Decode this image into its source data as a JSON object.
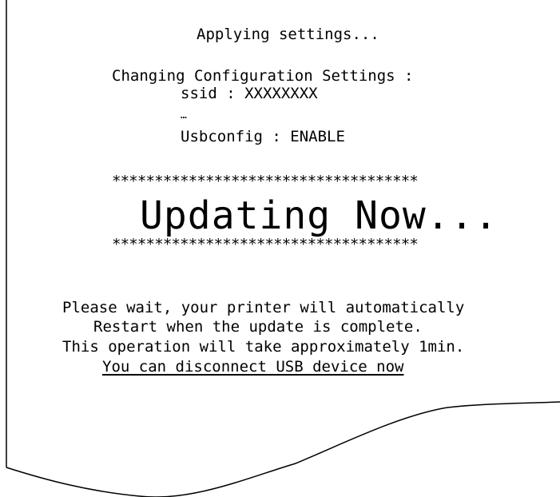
{
  "receipt": {
    "applying": "Applying settings...",
    "changing": "Changing Configuration Settings :",
    "ssid": "ssid : XXXXXXXX",
    "ellipsis": "…",
    "usbconfig": "Usbconfig : ENABLE",
    "stars_top": "************************************",
    "updating": "Updating Now...",
    "stars_bottom": "************************************",
    "message_line1": "Please wait, your printer will automatically",
    "message_line2": "Restart when the update is complete.",
    "message_line3": "This operation will take approximately 1min.",
    "message_line4": "You can disconnect USB device now"
  },
  "colors": {
    "text": "#000000",
    "paper": "#ffffff",
    "outline": "#000000"
  }
}
